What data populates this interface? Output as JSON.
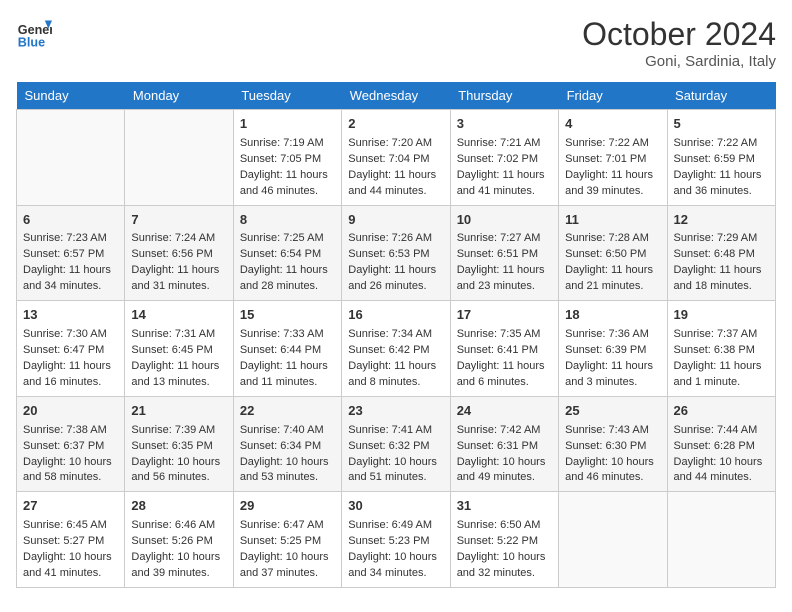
{
  "header": {
    "logo_line1": "General",
    "logo_line2": "Blue",
    "month": "October 2024",
    "location": "Goni, Sardinia, Italy"
  },
  "days_of_week": [
    "Sunday",
    "Monday",
    "Tuesday",
    "Wednesday",
    "Thursday",
    "Friday",
    "Saturday"
  ],
  "weeks": [
    [
      {
        "day": null
      },
      {
        "day": null
      },
      {
        "day": "1",
        "sunrise": "Sunrise: 7:19 AM",
        "sunset": "Sunset: 7:05 PM",
        "daylight": "Daylight: 11 hours and 46 minutes."
      },
      {
        "day": "2",
        "sunrise": "Sunrise: 7:20 AM",
        "sunset": "Sunset: 7:04 PM",
        "daylight": "Daylight: 11 hours and 44 minutes."
      },
      {
        "day": "3",
        "sunrise": "Sunrise: 7:21 AM",
        "sunset": "Sunset: 7:02 PM",
        "daylight": "Daylight: 11 hours and 41 minutes."
      },
      {
        "day": "4",
        "sunrise": "Sunrise: 7:22 AM",
        "sunset": "Sunset: 7:01 PM",
        "daylight": "Daylight: 11 hours and 39 minutes."
      },
      {
        "day": "5",
        "sunrise": "Sunrise: 7:22 AM",
        "sunset": "Sunset: 6:59 PM",
        "daylight": "Daylight: 11 hours and 36 minutes."
      }
    ],
    [
      {
        "day": "6",
        "sunrise": "Sunrise: 7:23 AM",
        "sunset": "Sunset: 6:57 PM",
        "daylight": "Daylight: 11 hours and 34 minutes."
      },
      {
        "day": "7",
        "sunrise": "Sunrise: 7:24 AM",
        "sunset": "Sunset: 6:56 PM",
        "daylight": "Daylight: 11 hours and 31 minutes."
      },
      {
        "day": "8",
        "sunrise": "Sunrise: 7:25 AM",
        "sunset": "Sunset: 6:54 PM",
        "daylight": "Daylight: 11 hours and 28 minutes."
      },
      {
        "day": "9",
        "sunrise": "Sunrise: 7:26 AM",
        "sunset": "Sunset: 6:53 PM",
        "daylight": "Daylight: 11 hours and 26 minutes."
      },
      {
        "day": "10",
        "sunrise": "Sunrise: 7:27 AM",
        "sunset": "Sunset: 6:51 PM",
        "daylight": "Daylight: 11 hours and 23 minutes."
      },
      {
        "day": "11",
        "sunrise": "Sunrise: 7:28 AM",
        "sunset": "Sunset: 6:50 PM",
        "daylight": "Daylight: 11 hours and 21 minutes."
      },
      {
        "day": "12",
        "sunrise": "Sunrise: 7:29 AM",
        "sunset": "Sunset: 6:48 PM",
        "daylight": "Daylight: 11 hours and 18 minutes."
      }
    ],
    [
      {
        "day": "13",
        "sunrise": "Sunrise: 7:30 AM",
        "sunset": "Sunset: 6:47 PM",
        "daylight": "Daylight: 11 hours and 16 minutes."
      },
      {
        "day": "14",
        "sunrise": "Sunrise: 7:31 AM",
        "sunset": "Sunset: 6:45 PM",
        "daylight": "Daylight: 11 hours and 13 minutes."
      },
      {
        "day": "15",
        "sunrise": "Sunrise: 7:33 AM",
        "sunset": "Sunset: 6:44 PM",
        "daylight": "Daylight: 11 hours and 11 minutes."
      },
      {
        "day": "16",
        "sunrise": "Sunrise: 7:34 AM",
        "sunset": "Sunset: 6:42 PM",
        "daylight": "Daylight: 11 hours and 8 minutes."
      },
      {
        "day": "17",
        "sunrise": "Sunrise: 7:35 AM",
        "sunset": "Sunset: 6:41 PM",
        "daylight": "Daylight: 11 hours and 6 minutes."
      },
      {
        "day": "18",
        "sunrise": "Sunrise: 7:36 AM",
        "sunset": "Sunset: 6:39 PM",
        "daylight": "Daylight: 11 hours and 3 minutes."
      },
      {
        "day": "19",
        "sunrise": "Sunrise: 7:37 AM",
        "sunset": "Sunset: 6:38 PM",
        "daylight": "Daylight: 11 hours and 1 minute."
      }
    ],
    [
      {
        "day": "20",
        "sunrise": "Sunrise: 7:38 AM",
        "sunset": "Sunset: 6:37 PM",
        "daylight": "Daylight: 10 hours and 58 minutes."
      },
      {
        "day": "21",
        "sunrise": "Sunrise: 7:39 AM",
        "sunset": "Sunset: 6:35 PM",
        "daylight": "Daylight: 10 hours and 56 minutes."
      },
      {
        "day": "22",
        "sunrise": "Sunrise: 7:40 AM",
        "sunset": "Sunset: 6:34 PM",
        "daylight": "Daylight: 10 hours and 53 minutes."
      },
      {
        "day": "23",
        "sunrise": "Sunrise: 7:41 AM",
        "sunset": "Sunset: 6:32 PM",
        "daylight": "Daylight: 10 hours and 51 minutes."
      },
      {
        "day": "24",
        "sunrise": "Sunrise: 7:42 AM",
        "sunset": "Sunset: 6:31 PM",
        "daylight": "Daylight: 10 hours and 49 minutes."
      },
      {
        "day": "25",
        "sunrise": "Sunrise: 7:43 AM",
        "sunset": "Sunset: 6:30 PM",
        "daylight": "Daylight: 10 hours and 46 minutes."
      },
      {
        "day": "26",
        "sunrise": "Sunrise: 7:44 AM",
        "sunset": "Sunset: 6:28 PM",
        "daylight": "Daylight: 10 hours and 44 minutes."
      }
    ],
    [
      {
        "day": "27",
        "sunrise": "Sunrise: 6:45 AM",
        "sunset": "Sunset: 5:27 PM",
        "daylight": "Daylight: 10 hours and 41 minutes."
      },
      {
        "day": "28",
        "sunrise": "Sunrise: 6:46 AM",
        "sunset": "Sunset: 5:26 PM",
        "daylight": "Daylight: 10 hours and 39 minutes."
      },
      {
        "day": "29",
        "sunrise": "Sunrise: 6:47 AM",
        "sunset": "Sunset: 5:25 PM",
        "daylight": "Daylight: 10 hours and 37 minutes."
      },
      {
        "day": "30",
        "sunrise": "Sunrise: 6:49 AM",
        "sunset": "Sunset: 5:23 PM",
        "daylight": "Daylight: 10 hours and 34 minutes."
      },
      {
        "day": "31",
        "sunrise": "Sunrise: 6:50 AM",
        "sunset": "Sunset: 5:22 PM",
        "daylight": "Daylight: 10 hours and 32 minutes."
      },
      {
        "day": null
      },
      {
        "day": null
      }
    ]
  ]
}
